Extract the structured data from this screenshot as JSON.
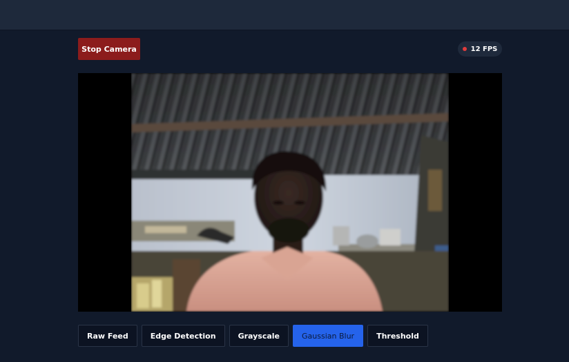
{
  "toolbar": {
    "stop_label": "Stop Camera",
    "fps_label": "12 FPS"
  },
  "filters": [
    {
      "label": "Raw Feed",
      "active": false
    },
    {
      "label": "Edge Detection",
      "active": false
    },
    {
      "label": "Grayscale",
      "active": false
    },
    {
      "label": "Gaussian Blur",
      "active": true
    },
    {
      "label": "Threshold",
      "active": false
    }
  ],
  "colors": {
    "background": "#111a2b",
    "header": "#1e293b",
    "stop_button": "#8c1c1c",
    "active_filter": "#2563eb",
    "live_dot": "#e03c3c"
  }
}
